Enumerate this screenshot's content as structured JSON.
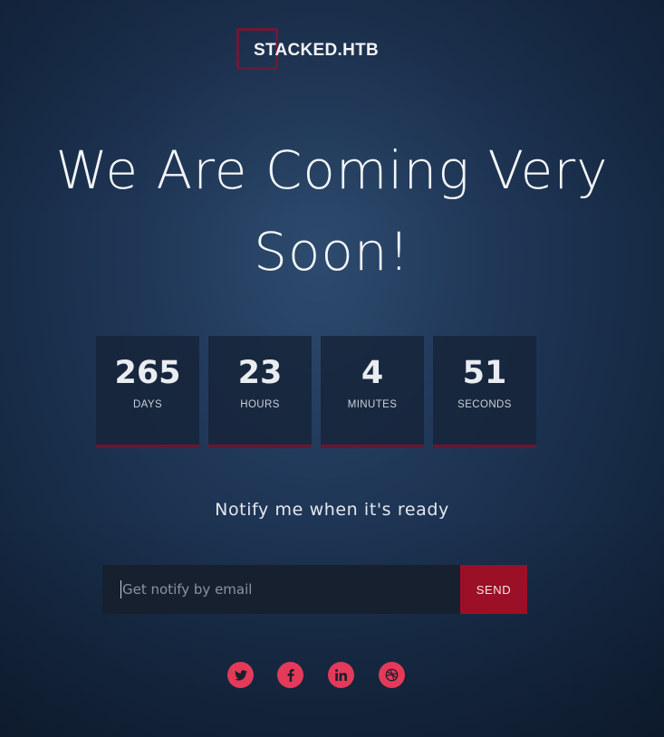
{
  "brand": {
    "name": "STACKED.HTB",
    "logo_frame_color": "#6b1a35"
  },
  "headline": {
    "line1": "We Are Coming Very",
    "line2": "Soon!"
  },
  "countdown": [
    {
      "value": "265",
      "label": "DAYS"
    },
    {
      "value": "23",
      "label": "HOURS"
    },
    {
      "value": "4",
      "label": "MINUTES"
    },
    {
      "value": "51",
      "label": "SECONDS"
    }
  ],
  "notify": {
    "title": "Notify me when it's ready",
    "placeholder": "Get notify by email",
    "value": "",
    "button_label": "SEND"
  },
  "social": [
    {
      "name": "twitter",
      "icon": "twitter-icon"
    },
    {
      "name": "facebook",
      "icon": "facebook-icon"
    },
    {
      "name": "linkedin",
      "icon": "linkedin-icon"
    },
    {
      "name": "dribbble",
      "icon": "dribbble-icon"
    }
  ],
  "colors": {
    "accent": "#9b1026",
    "social_circle": "#e43a5a",
    "background": "#1f3656"
  }
}
